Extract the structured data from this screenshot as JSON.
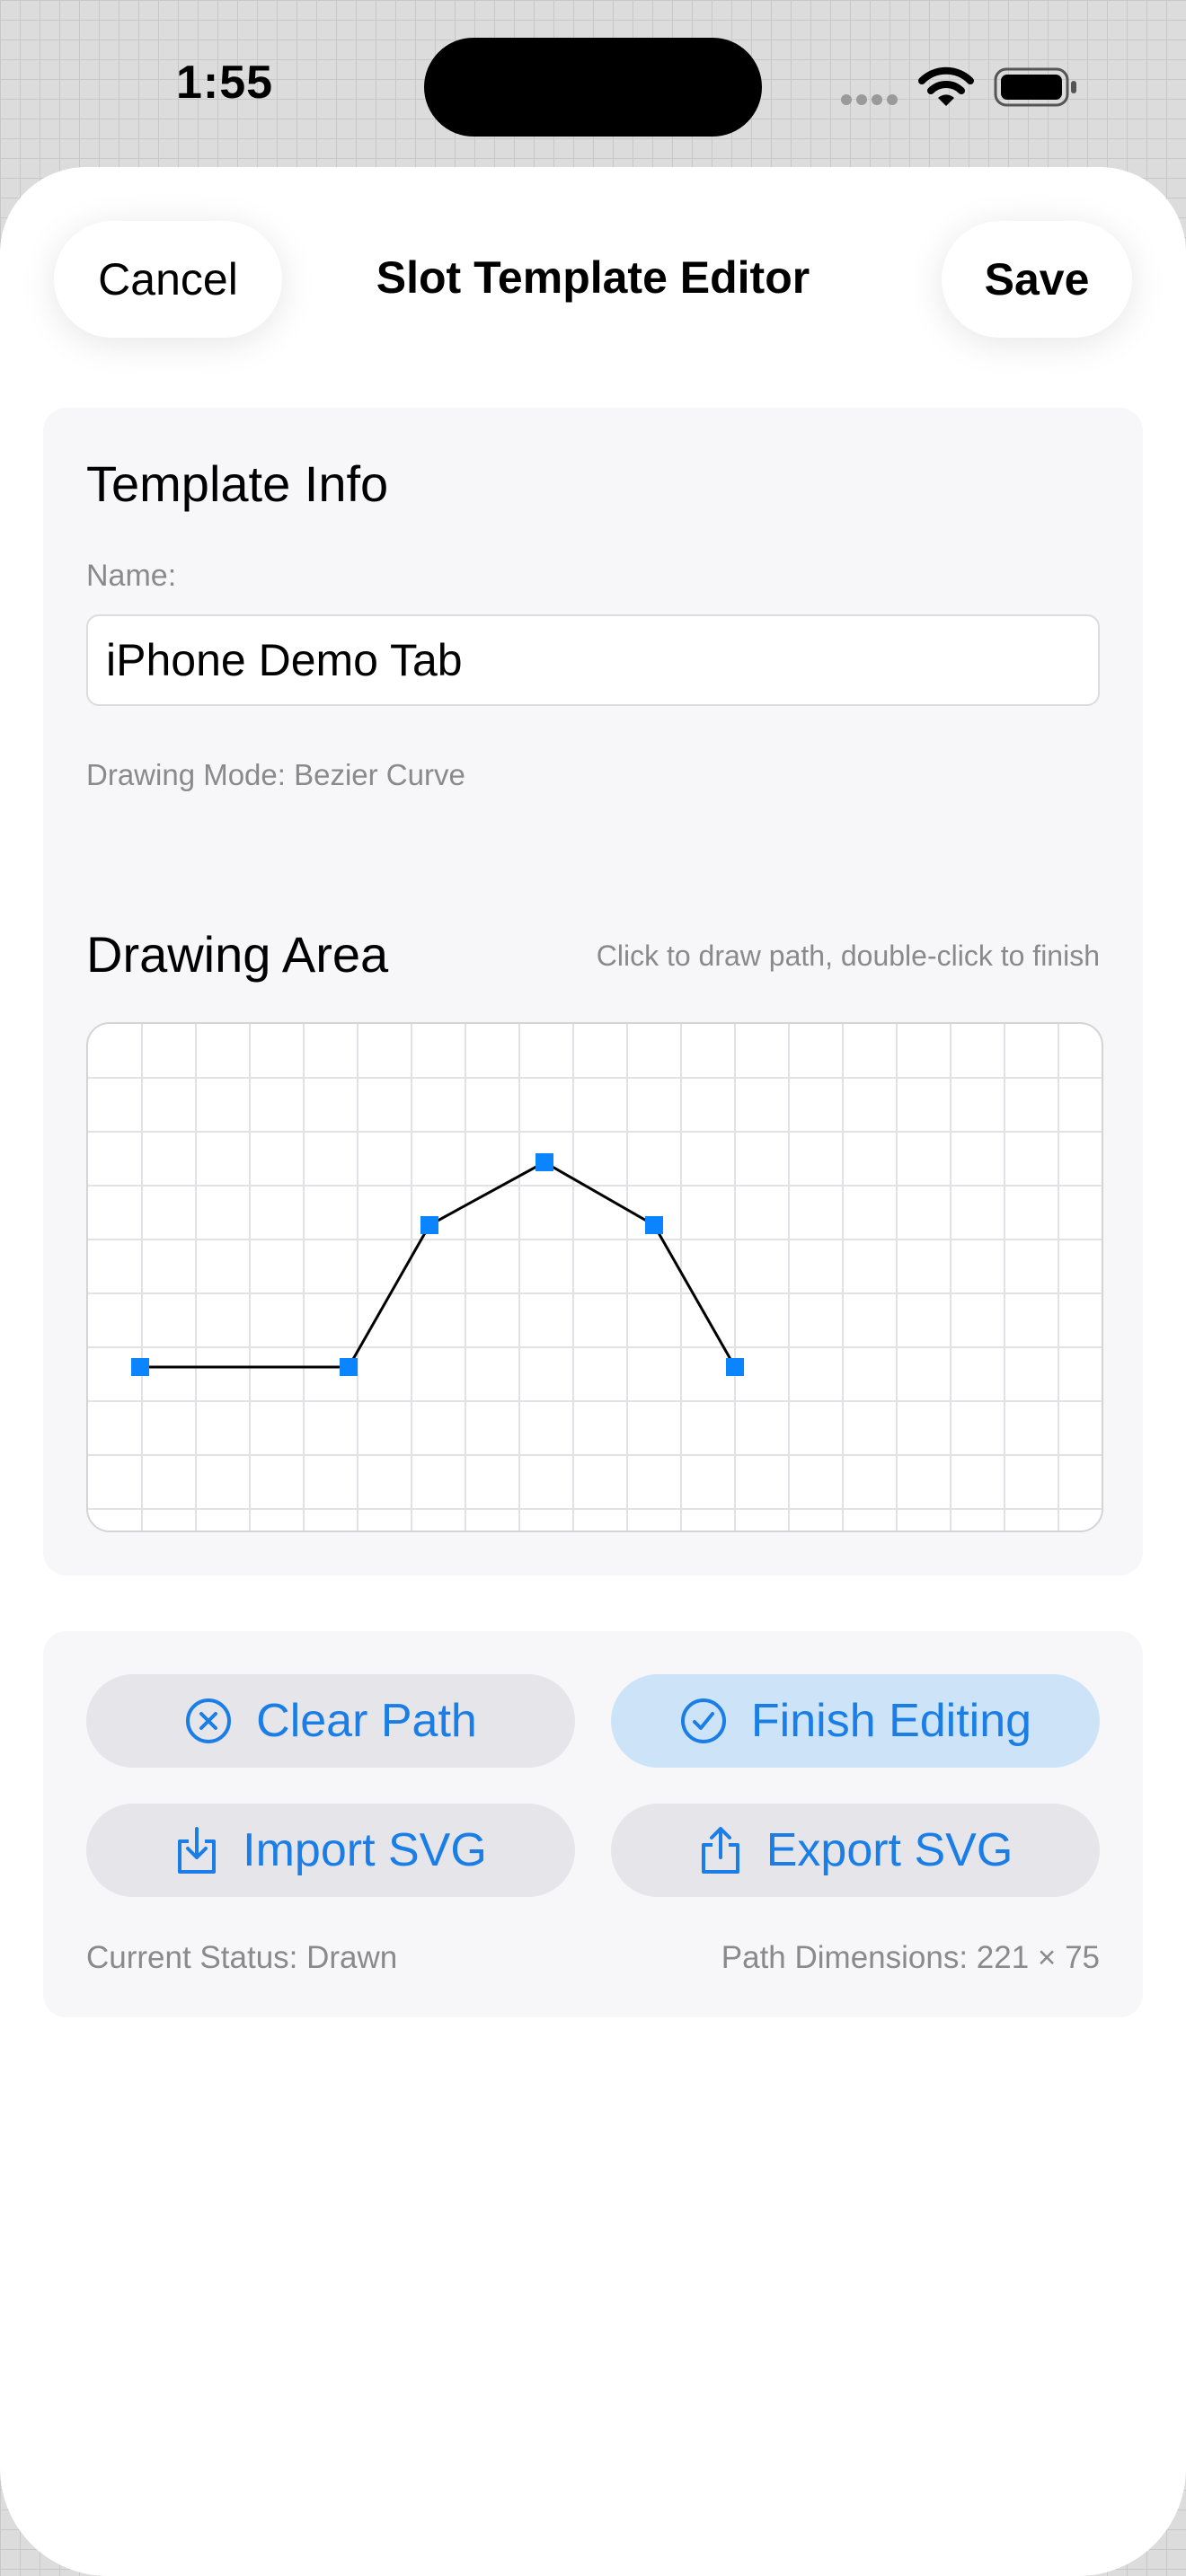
{
  "status_bar": {
    "time": "1:55"
  },
  "nav": {
    "cancel_label": "Cancel",
    "title": "Slot Template Editor",
    "save_label": "Save"
  },
  "template_info": {
    "heading": "Template Info",
    "name_label": "Name:",
    "name_value": "iPhone Demo Tab",
    "drawing_mode": "Drawing Mode: Bezier Curve"
  },
  "drawing_area": {
    "heading": "Drawing Area",
    "hint": "Click to draw path, double-click to finish"
  },
  "actions": {
    "clear_label": "Clear Path",
    "finish_label": "Finish Editing",
    "import_label": "Import SVG",
    "export_label": "Export SVG",
    "status_text": "Current Status: Drawn",
    "dimensions_text": "Path Dimensions: 221 × 75"
  },
  "colors": {
    "accent": "#1a7ee6",
    "point": "#0a84ff",
    "primary_button_bg": "#cde4f8"
  },
  "icons": {
    "clear": "x-circle-icon",
    "finish": "checkmark-circle-icon",
    "import": "tray-download-icon",
    "export": "share-upload-icon"
  }
}
